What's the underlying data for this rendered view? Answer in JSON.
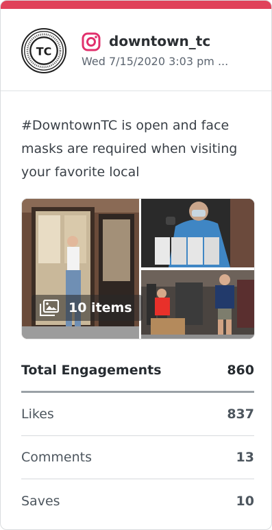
{
  "colors": {
    "accent": "#e0425a",
    "instagram": "#e1306c"
  },
  "post": {
    "account": "downtown_tc",
    "timestamp": "Wed 7/15/2020 3:03 pm ...",
    "network_icon": "instagram-icon",
    "caption": "#DowntownTC is open and face masks are required when visiting your favorite local",
    "media": {
      "count_label": "10 items",
      "icon": "gallery-icon"
    }
  },
  "metrics": {
    "total": {
      "label": "Total Engagements",
      "value": "860"
    },
    "rows": [
      {
        "label": "Likes",
        "value": "837"
      },
      {
        "label": "Comments",
        "value": "13"
      },
      {
        "label": "Saves",
        "value": "10"
      }
    ]
  }
}
